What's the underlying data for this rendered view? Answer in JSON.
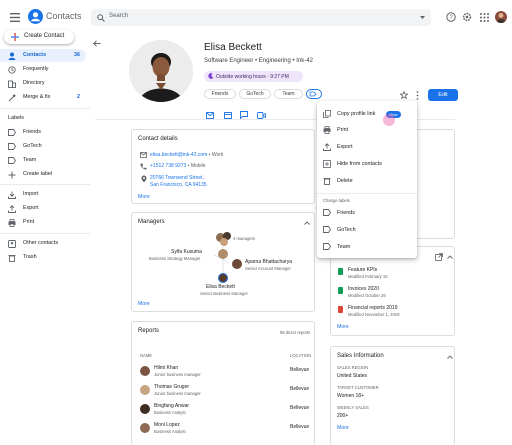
{
  "app": {
    "title": "Contacts"
  },
  "search": {
    "placeholder": "Search"
  },
  "sidebar": {
    "create_label": "Create Contact",
    "items": [
      {
        "label": "Contacts",
        "count": "36"
      },
      {
        "label": "Frequently"
      },
      {
        "label": "Directory"
      },
      {
        "label": "Merge & fix",
        "count": "2"
      }
    ],
    "labels_header": "Labels",
    "labels": [
      {
        "label": "Friends"
      },
      {
        "label": "GoTech"
      },
      {
        "label": "Team"
      },
      {
        "label": "Create label"
      }
    ],
    "tools": [
      {
        "label": "Import"
      },
      {
        "label": "Export"
      },
      {
        "label": "Print"
      }
    ],
    "other": [
      {
        "label": "Other contacts"
      },
      {
        "label": "Trash"
      }
    ]
  },
  "contact": {
    "name": "Elisa Beckett",
    "subtitle": "Software Engineer • Engineering • Ink-42",
    "working_hours": "Outside working hours · 9:27 PM",
    "chips": [
      "Friends",
      "GoTech",
      "Team"
    ],
    "edit_label": "Edit"
  },
  "contact_details": {
    "title": "Contact details",
    "email": "elisa.beckett@ink-42.com",
    "email_type": "Work",
    "phone": "+1512 738 9273",
    "phone_type": "Mobile",
    "address_line1": "20766 Townsend Street,",
    "address_line2": "San Francisco, CA 94135",
    "more": "More"
  },
  "managers": {
    "title": "Managers",
    "manager_count": "4 managers",
    "people": [
      {
        "name": "Sylfa Kusuma",
        "role": "Business Strategy Manager"
      },
      {
        "name": "Aparna Bhattacharya",
        "role": "Senior Account Manager"
      },
      {
        "name": "Elisa Beckett",
        "role": "Senior Business Manager"
      }
    ],
    "more": "More"
  },
  "reports": {
    "title": "Reports",
    "count_label": "98 direct reports",
    "col_name": "NAME",
    "col_location": "LOCATION",
    "rows": [
      {
        "name": "Hilmi Khan",
        "role": "Junior business manager",
        "location": "Bellevue"
      },
      {
        "name": "Thomas Gruger",
        "role": "Junior business manager",
        "location": "Bellevue"
      },
      {
        "name": "Bingfang Anwar",
        "role": "Business Analyst",
        "location": "Bellevue"
      },
      {
        "name": "Moni Lopez",
        "role": "Business Analyst",
        "location": "Bellevue"
      }
    ]
  },
  "files": {
    "items": [
      {
        "name": "Feature KPIs",
        "modified": "Modified February 15"
      },
      {
        "name": "Invoices 2020",
        "modified": "Modified October 26"
      },
      {
        "name": "Financial reports 2019",
        "modified": "Modified November 1, 2019"
      }
    ],
    "more": "More"
  },
  "sales": {
    "title": "Sales Information",
    "fields": [
      {
        "label": "SALES REGION",
        "value": "United States"
      },
      {
        "label": "TARGET CUSTOMER",
        "value": "Women 18+"
      },
      {
        "label": "WEEKLY SALES",
        "value": "200+"
      }
    ],
    "more": "More"
  },
  "menu": {
    "items": [
      {
        "label": "Copy profile link",
        "badge": "New"
      },
      {
        "label": "Print"
      },
      {
        "label": "Export"
      },
      {
        "label": "Hide from contacts"
      },
      {
        "label": "Delete"
      }
    ],
    "change_labels_header": "Change labels",
    "labels": [
      {
        "label": "Friends"
      },
      {
        "label": "GoTech"
      },
      {
        "label": "Team"
      }
    ]
  },
  "colors": {
    "accent": "#1a73e8",
    "active_nav_bg": "#e8f0fe",
    "working_hours_bg": "#efe5fb",
    "sheets_green": "#0f9d58",
    "docs_blue": "#4285f4",
    "slides_red": "#db4437"
  }
}
